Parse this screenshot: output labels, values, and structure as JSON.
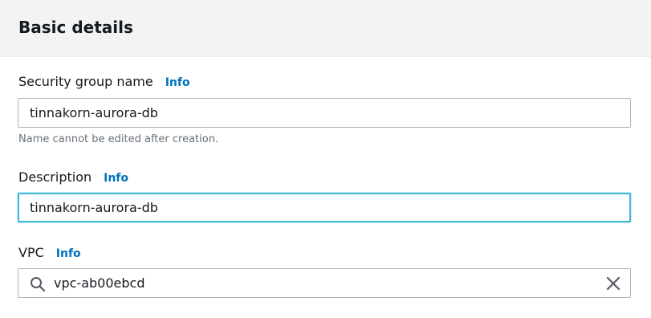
{
  "panel": {
    "title": "Basic details"
  },
  "fields": {
    "security_group_name": {
      "label": "Security group name",
      "info": "Info",
      "value": "tinnakorn-aurora-db",
      "hint": "Name cannot be edited after creation."
    },
    "description": {
      "label": "Description",
      "info": "Info",
      "value": "tinnakorn-aurora-db"
    },
    "vpc": {
      "label": "VPC",
      "info": "Info",
      "value": "vpc-ab00ebcd"
    }
  },
  "colors": {
    "header_bg": "#f2f3f3",
    "info_link": "#0073bb",
    "focus_border": "#44b9d6",
    "input_border": "#aab7b8",
    "hint_text": "#687078"
  },
  "icons": {
    "search": "search-icon",
    "clear": "close-icon"
  }
}
